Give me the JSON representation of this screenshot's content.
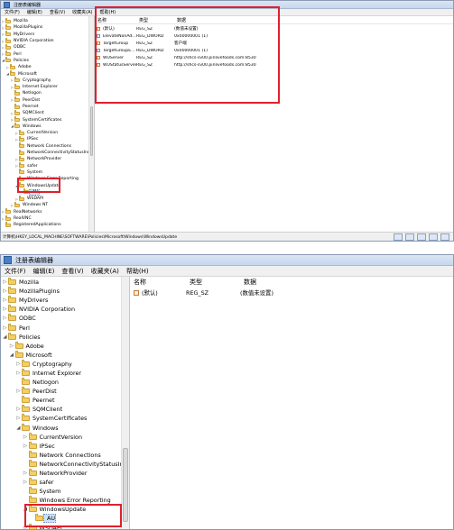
{
  "app": {
    "title": "注册表编辑器"
  },
  "menu": [
    "文件(F)",
    "编辑(E)",
    "查看(V)",
    "收藏夹(A)",
    "帮助(H)"
  ],
  "columns": {
    "name": "名称",
    "type": "类型",
    "data": "数据"
  },
  "shot1": {
    "tree": [
      {
        "label": "Mozilla",
        "depth": 0,
        "exp": "▷"
      },
      {
        "label": "MozillaPlugins",
        "depth": 0,
        "exp": "▷"
      },
      {
        "label": "MyDrivers",
        "depth": 0,
        "exp": "▷"
      },
      {
        "label": "NVIDIA Corporation",
        "depth": 0,
        "exp": "▷"
      },
      {
        "label": "ODBC",
        "depth": 0,
        "exp": "▷"
      },
      {
        "label": "Perl",
        "depth": 0,
        "exp": "▷"
      },
      {
        "label": "Policies",
        "depth": 0,
        "exp": "◢"
      },
      {
        "label": "Adobe",
        "depth": 1,
        "exp": "▷"
      },
      {
        "label": "Microsoft",
        "depth": 1,
        "exp": "◢"
      },
      {
        "label": "Cryptography",
        "depth": 2,
        "exp": "▷"
      },
      {
        "label": "Internet Explorer",
        "depth": 2,
        "exp": "▷"
      },
      {
        "label": "Netlogon",
        "depth": 2,
        "exp": ""
      },
      {
        "label": "PeerDist",
        "depth": 2,
        "exp": "▷"
      },
      {
        "label": "Peernet",
        "depth": 2,
        "exp": ""
      },
      {
        "label": "SQMClient",
        "depth": 2,
        "exp": "▷"
      },
      {
        "label": "SystemCertificates",
        "depth": 2,
        "exp": "▷"
      },
      {
        "label": "Windows",
        "depth": 2,
        "exp": "◢"
      },
      {
        "label": "CurrentVersion",
        "depth": 3,
        "exp": "▷"
      },
      {
        "label": "IPSec",
        "depth": 3,
        "exp": "▷"
      },
      {
        "label": "Network Connections",
        "depth": 3,
        "exp": ""
      },
      {
        "label": "NetworkConnectivityStatusInd",
        "depth": 3,
        "exp": ""
      },
      {
        "label": "NetworkProvider",
        "depth": 3,
        "exp": "▷"
      },
      {
        "label": "safer",
        "depth": 3,
        "exp": "▷"
      },
      {
        "label": "System",
        "depth": 3,
        "exp": ""
      },
      {
        "label": "Windows Error Reporting",
        "depth": 3,
        "exp": ""
      },
      {
        "label": "WindowsUpdate",
        "depth": 3,
        "exp": "◢"
      },
      {
        "label": "AU",
        "depth": 4,
        "exp": "",
        "selected": true
      },
      {
        "label": "WSDAPI",
        "depth": 3,
        "exp": "▷"
      },
      {
        "label": "Windows NT",
        "depth": 2,
        "exp": "▷"
      },
      {
        "label": "RealNetworks",
        "depth": 0,
        "exp": "▷"
      },
      {
        "label": "RealVNC",
        "depth": 0,
        "exp": "▷"
      },
      {
        "label": "RegisteredApplications",
        "depth": 0,
        "exp": ""
      }
    ],
    "values": [
      {
        "name": "(默认)",
        "type": "REG_SZ",
        "data": "(数值未设置)",
        "icon": "ab"
      },
      {
        "name": "ElevateNonAd...",
        "type": "REG_DWORD",
        "data": "0x00000001 (1)",
        "icon": "bin"
      },
      {
        "name": "TargetGroup",
        "type": "REG_SZ",
        "data": "客户端",
        "icon": "ab"
      },
      {
        "name": "TargetGroupE...",
        "type": "REG_DWORD",
        "data": "0x00000001 (1)",
        "icon": "bin"
      },
      {
        "name": "WUServer",
        "type": "REG_SZ",
        "data": "http://shcs-sv00.pinlivefoods.com:8530",
        "icon": "ab"
      },
      {
        "name": "WUStatusServer",
        "type": "REG_SZ",
        "data": "http://shcs-sv00.pinlivefoods.com:8530",
        "icon": "ab"
      }
    ],
    "status": "计算机\\HKEY_LOCAL_MACHINE\\SOFTWARE\\Policies\\Microsoft\\Windows\\WindowsUpdate"
  },
  "shot2": {
    "tree": [
      {
        "label": "Mozilla",
        "depth": 0,
        "exp": "▷"
      },
      {
        "label": "MozillaPlugins",
        "depth": 0,
        "exp": "▷"
      },
      {
        "label": "MyDrivers",
        "depth": 0,
        "exp": "▷"
      },
      {
        "label": "NVIDIA Corporation",
        "depth": 0,
        "exp": "▷"
      },
      {
        "label": "ODBC",
        "depth": 0,
        "exp": "▷"
      },
      {
        "label": "Perl",
        "depth": 0,
        "exp": "▷"
      },
      {
        "label": "Policies",
        "depth": 0,
        "exp": "◢"
      },
      {
        "label": "Adobe",
        "depth": 1,
        "exp": "▷"
      },
      {
        "label": "Microsoft",
        "depth": 1,
        "exp": "◢"
      },
      {
        "label": "Cryptography",
        "depth": 2,
        "exp": "▷"
      },
      {
        "label": "Internet Explorer",
        "depth": 2,
        "exp": "▷"
      },
      {
        "label": "Netlogon",
        "depth": 2,
        "exp": ""
      },
      {
        "label": "PeerDist",
        "depth": 2,
        "exp": "▷"
      },
      {
        "label": "Peernet",
        "depth": 2,
        "exp": ""
      },
      {
        "label": "SQMClient",
        "depth": 2,
        "exp": "▷"
      },
      {
        "label": "SystemCertificates",
        "depth": 2,
        "exp": "▷"
      },
      {
        "label": "Windows",
        "depth": 2,
        "exp": "◢"
      },
      {
        "label": "CurrentVersion",
        "depth": 3,
        "exp": "▷"
      },
      {
        "label": "IPSec",
        "depth": 3,
        "exp": "▷"
      },
      {
        "label": "Network Connections",
        "depth": 3,
        "exp": ""
      },
      {
        "label": "NetworkConnectivityStatusInd",
        "depth": 3,
        "exp": ""
      },
      {
        "label": "NetworkProvider",
        "depth": 3,
        "exp": "▷"
      },
      {
        "label": "safer",
        "depth": 3,
        "exp": "▷"
      },
      {
        "label": "System",
        "depth": 3,
        "exp": ""
      },
      {
        "label": "Windows Error Reporting",
        "depth": 3,
        "exp": ""
      },
      {
        "label": "WindowsUpdate",
        "depth": 3,
        "exp": "◢"
      },
      {
        "label": "AU",
        "depth": 4,
        "exp": "",
        "selected": true
      },
      {
        "label": "WSDAPI",
        "depth": 3,
        "exp": "▷"
      }
    ],
    "values": [
      {
        "name": "(默认)",
        "type": "REG_SZ",
        "data": "(数值未设置)",
        "icon": "ab"
      }
    ]
  }
}
